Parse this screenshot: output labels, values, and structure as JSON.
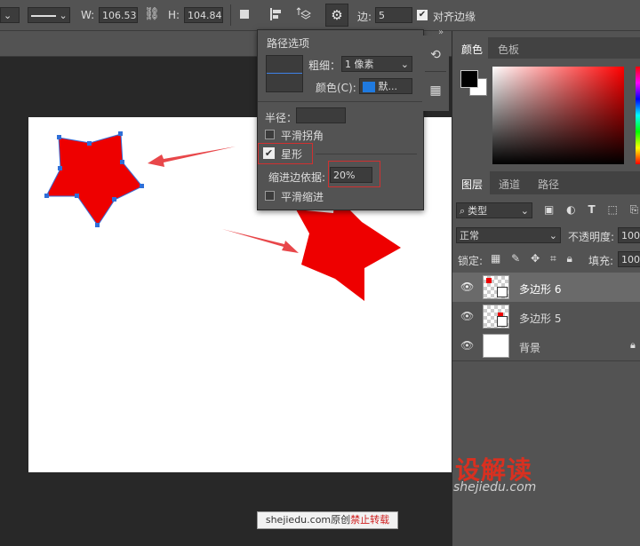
{
  "options_bar": {
    "w_label": "W:",
    "w_value": "106.53 ",
    "h_label": "H:",
    "h_value": "104.84 ",
    "sides_label": "边:",
    "sides_value": "5",
    "align_edges_label": "对齐边缘",
    "align_edges_checked": true
  },
  "path_options": {
    "title": "路径选项",
    "weight_label": "粗细：",
    "weight_value": "1 像素",
    "color_label": "颜色(C):",
    "color_value": "默...",
    "color_swatch": "#1f7ae0",
    "radius_label": "半径：",
    "radius_value": "",
    "smooth_corners_label": "平滑拐角",
    "smooth_corners_checked": false,
    "star_label": "星形",
    "star_checked": true,
    "indent_label": "缩进边依据:",
    "indent_value": "20%",
    "smooth_indent_label": "平滑缩进",
    "smooth_indent_checked": false
  },
  "color_panel": {
    "tabs": [
      "颜色",
      "色板"
    ],
    "foreground": "#000000",
    "background": "#ffffff",
    "hue_color": "#ff0000"
  },
  "layers_panel": {
    "tabs": [
      "图层",
      "通道",
      "路径"
    ],
    "filter_label": "类型",
    "blend_mode": "正常",
    "opacity_label": "不透明度:",
    "opacity_value": "100%",
    "lock_label": "锁定:",
    "fill_label": "填充:",
    "fill_value": "100%",
    "layers": [
      {
        "name": "多边形 6",
        "selected": true
      },
      {
        "name": "多边形 5",
        "selected": false
      },
      {
        "name": "背景",
        "selected": false
      }
    ]
  },
  "canvas": {
    "star_color": "#ee0000",
    "arrow_color": "#e8474a"
  },
  "watermarks": {
    "brand": "设解读",
    "domain": "shejiedu.com",
    "footer_site": "shejiedu.com原创",
    "footer_warning": "禁止转载"
  }
}
